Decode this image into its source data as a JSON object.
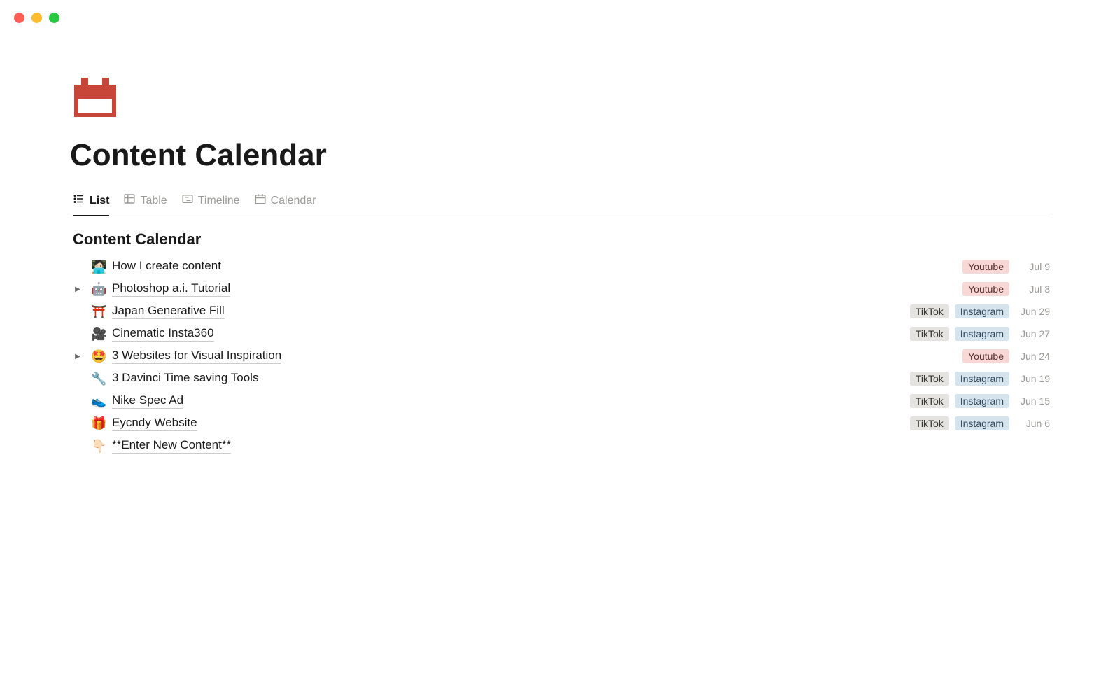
{
  "page": {
    "title": "Content Calendar",
    "section_title": "Content Calendar"
  },
  "tabs": [
    {
      "label": "List",
      "active": true
    },
    {
      "label": "Table",
      "active": false
    },
    {
      "label": "Timeline",
      "active": false
    },
    {
      "label": "Calendar",
      "active": false
    }
  ],
  "tag_styles": {
    "Youtube": "tag-youtube",
    "TikTok": "tag-tiktok",
    "Instagram": "tag-instagram"
  },
  "items": [
    {
      "emoji": "🧑🏻‍💻",
      "title": "How I create content",
      "toggle": false,
      "tags": [
        "Youtube"
      ],
      "date": "Jul 9"
    },
    {
      "emoji": "🤖",
      "title": "Photoshop a.i. Tutorial",
      "toggle": true,
      "tags": [
        "Youtube"
      ],
      "date": "Jul 3"
    },
    {
      "emoji": "⛩️",
      "title": "Japan Generative Fill",
      "toggle": false,
      "tags": [
        "TikTok",
        "Instagram"
      ],
      "date": "Jun 29"
    },
    {
      "emoji": "🎥",
      "title": "Cinematic Insta360",
      "toggle": false,
      "tags": [
        "TikTok",
        "Instagram"
      ],
      "date": "Jun 27"
    },
    {
      "emoji": "🤩",
      "title": "3 Websites for Visual Inspiration",
      "toggle": true,
      "tags": [
        "Youtube"
      ],
      "date": "Jun 24"
    },
    {
      "emoji": "🔧",
      "title": "3 Davinci Time saving Tools",
      "toggle": false,
      "tags": [
        "TikTok",
        "Instagram"
      ],
      "date": "Jun 19"
    },
    {
      "emoji": "👟",
      "title": "Nike Spec Ad",
      "toggle": false,
      "tags": [
        "TikTok",
        "Instagram"
      ],
      "date": "Jun 15"
    },
    {
      "emoji": "🎁",
      "title": "Eycndy Website",
      "toggle": false,
      "tags": [
        "TikTok",
        "Instagram"
      ],
      "date": "Jun 6"
    },
    {
      "emoji": "👇🏻",
      "title": "**Enter New Content**",
      "toggle": false,
      "tags": [],
      "date": ""
    }
  ]
}
